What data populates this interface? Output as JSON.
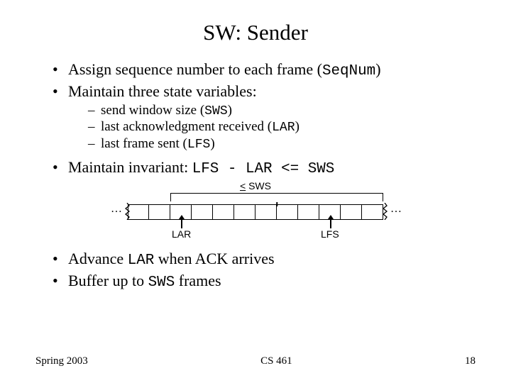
{
  "title": "SW: Sender",
  "bullets": {
    "b1_pre": "Assign sequence number to each frame (",
    "b1_code": "SeqNum",
    "b1_post": ")",
    "b2": "Maintain three state variables:",
    "s1_pre": "send window size (",
    "s1_code": "SWS",
    "s1_post": ")",
    "s2_pre": "last acknowledgment received (",
    "s2_code": "LAR",
    "s2_post": ")",
    "s3_pre": "last frame sent (",
    "s3_code": "LFS",
    "s3_post": ")",
    "b3_pre": "Maintain invariant: ",
    "b3_code": "LFS - LAR <= SWS",
    "b4_pre": "Advance ",
    "b4_code": "LAR",
    "b4_post": " when ACK arrives",
    "b5_pre": "Buffer up to ",
    "b5_code": "SWS",
    "b5_post": " frames"
  },
  "diagram": {
    "ellipsis": "…",
    "sws_le": "<",
    "sws_label": " SWS",
    "lar": "LAR",
    "lfs": "LFS"
  },
  "footer": {
    "left": "Spring 2003",
    "center": "CS 461",
    "right": "18"
  }
}
